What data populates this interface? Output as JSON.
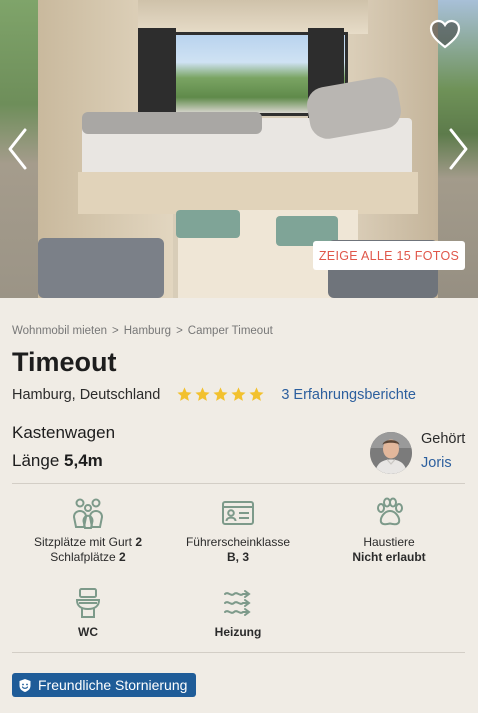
{
  "gallery": {
    "show_photos_label": "ZEIGE ALLE 15 FOTOS",
    "prev_icon": "chevron-left-icon",
    "next_icon": "chevron-right-icon",
    "favorite_icon": "heart-icon"
  },
  "breadcrumb": {
    "items": [
      "Wohnmobil mieten",
      "Hamburg",
      "Camper Timeout"
    ],
    "separator": ">"
  },
  "listing": {
    "title": "Timeout",
    "location": "Hamburg, Deutschland",
    "rating": 5,
    "rating_max": 5,
    "reviews_label": "3 Erfahrungsberichte",
    "vehicle_type": "Kastenwagen",
    "length_label": "Länge",
    "length_value": "5,4m"
  },
  "owner": {
    "label": "Gehört",
    "name": "Joris"
  },
  "features": {
    "seats": {
      "icon": "people-icon",
      "line1_label": "Sitzplätze mit Gurt",
      "line1_value": "2",
      "line2_label": "Schlafplätze",
      "line2_value": "2"
    },
    "license": {
      "icon": "license-card-icon",
      "label": "Führerscheinklasse",
      "value": "B, 3"
    },
    "pets": {
      "icon": "paw-icon",
      "label": "Haustiere",
      "value": "Nicht erlaubt"
    },
    "wc": {
      "icon": "toilet-icon",
      "value": "WC"
    },
    "heating": {
      "icon": "heating-icon",
      "value": "Heizung"
    }
  },
  "cancellation": {
    "icon": "smile-shield-icon",
    "label": "Freundliche Stornierung"
  },
  "colors": {
    "accent_blue": "#1f5c98",
    "link_blue": "#2c5f9e",
    "photo_button_text": "#e0574a",
    "star_yellow": "#f2c12e",
    "icon_green": "#7d9a8a",
    "background": "#f0ece5"
  }
}
